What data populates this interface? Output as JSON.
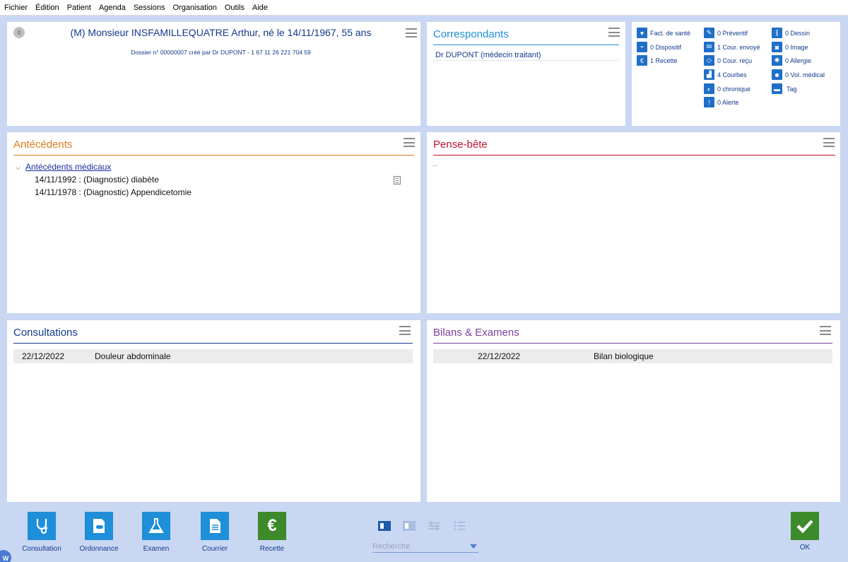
{
  "menu": [
    "Fichier",
    "Édition",
    "Patient",
    "Agenda",
    "Sessions",
    "Organisation",
    "Outils",
    "Aide"
  ],
  "patient": {
    "badge": "0",
    "title": "(M) Monsieur INSFAMILLEQUATRE Arthur, né le 14/11/1967, 55 ans",
    "subtitle": "Dossier n° 00000007 créé par Dr DUPONT - 1 67 11 26 221 704 59"
  },
  "correspondants": {
    "title": "Correspondants",
    "items": [
      "Dr DUPONT (médecin traitant)"
    ],
    "color": "#1e8fd8"
  },
  "summary": {
    "col1": [
      "Fact. de santé",
      "0 Dispositif",
      "1 Recette"
    ],
    "col2": [
      "0 Préventif",
      "1 Cour. envoyé",
      "0 Cour. reçu",
      "4 Courbes",
      "0 chronique",
      "0 Alerte"
    ],
    "col3": [
      "0 Dessin",
      "0 Image",
      "0 Allergie",
      "0 Vol. médical",
      "Tag"
    ],
    "icons_col1": [
      "heart-icon",
      "syringe-icon",
      "euro-icon"
    ],
    "icons_col2": [
      "pen-icon",
      "envelope-icon",
      "open-envelope-icon",
      "chart-icon",
      "pill-icon",
      "exclamation-icon"
    ],
    "icons_col3": [
      "drawing-icon",
      "camera-icon",
      "allergy-icon",
      "robot-icon",
      "folder-icon"
    ]
  },
  "antecedents": {
    "title": "Antécédents",
    "color": "#e07b1a",
    "group": "Antécédents médicaux",
    "rows": [
      "14/11/1992 : (Diagnostic) diabète",
      "14/11/1978 : (Diagnostic) Appendicetomie"
    ]
  },
  "pense_bete": {
    "title": "Pense-bête",
    "color": "#c8102e",
    "text": "..."
  },
  "consultations": {
    "title": "Consultations",
    "color": "#123a8c",
    "rows": [
      {
        "date": "22/12/2022",
        "label": "Douleur abdominale"
      }
    ]
  },
  "bilans": {
    "title": "Bilans & Examens",
    "color": "#7b3fa0",
    "rows": [
      {
        "date": "22/12/2022",
        "label": "Bilan biologique"
      }
    ]
  },
  "toolbar": {
    "buttons": [
      "Consultation",
      "Ordonnance",
      "Examen",
      "Courrier",
      "Recette"
    ],
    "button_icons": [
      "stethoscope-icon",
      "prescription-icon",
      "flask-icon",
      "document-icon",
      "euro-icon"
    ],
    "search_placeholder": "Recherche",
    "ok_label": "OK",
    "accent": "#1e8fd8",
    "recette_color": "#3c8a2a"
  },
  "logo_letter": "W"
}
